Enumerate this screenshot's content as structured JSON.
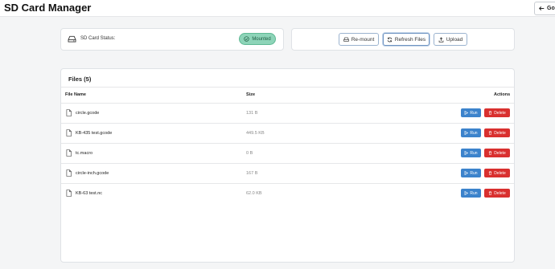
{
  "header": {
    "title": "SD Card Manager",
    "go_label": "Go",
    "go_icon": "arrow-left-icon"
  },
  "status": {
    "label": "SD Card Status:",
    "badge": "Mounted",
    "badge_color": "#8dd4b8",
    "icon": "drive-icon"
  },
  "actions": {
    "remount_label": "Re-mount",
    "refresh_label": "Refresh Files",
    "upload_label": "Upload"
  },
  "files": {
    "title": "Files (5)",
    "columns": {
      "name": "File Name",
      "size": "Size",
      "actions": "Actions"
    },
    "run_label": "Run",
    "delete_label": "Delete",
    "run_color": "#3c83cc",
    "delete_color": "#d9302f",
    "rows": [
      {
        "name": "circle.gcode",
        "size": "131 B"
      },
      {
        "name": "KB-435 test.gcode",
        "size": "449.5 KB"
      },
      {
        "name": "tc.macro",
        "size": "0 B"
      },
      {
        "name": "circle-inch.gcode",
        "size": "167 B"
      },
      {
        "name": "KB-63 test.nc",
        "size": "62.0 KB"
      }
    ]
  }
}
